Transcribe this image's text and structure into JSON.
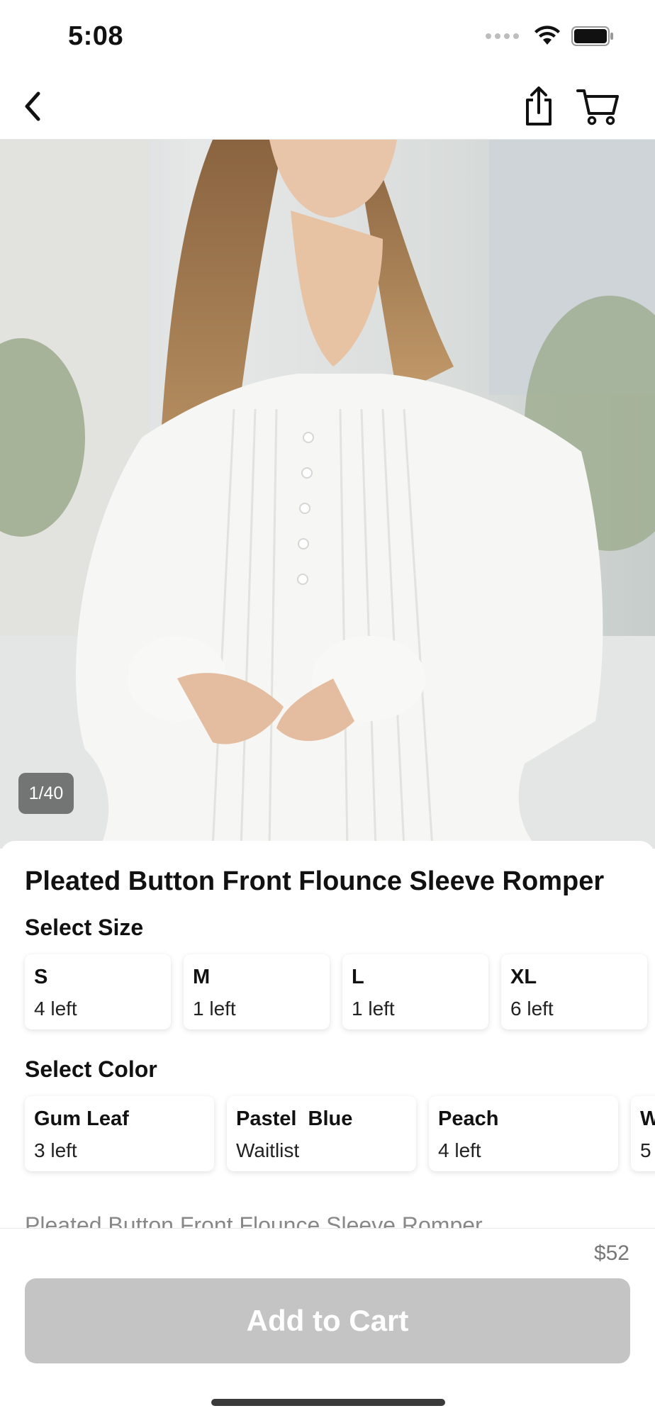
{
  "status_bar": {
    "time": "5:08",
    "icons": [
      "signal-dots-icon",
      "wifi-icon",
      "battery-icon"
    ]
  },
  "nav": {
    "icons": [
      "chevron-left-icon",
      "share-icon",
      "shopping-cart-icon"
    ]
  },
  "gallery": {
    "counter": "1/40"
  },
  "product": {
    "title": "Pleated Button Front Flounce Sleeve Romper",
    "description_preview": "Pleated Button Front Flounce Sleeve Romper",
    "price": "$52"
  },
  "size_section": {
    "title": "Select Size",
    "options": [
      {
        "name": "S",
        "stock": "4 left"
      },
      {
        "name": "M",
        "stock": "1 left"
      },
      {
        "name": "L",
        "stock": "1 left"
      },
      {
        "name": "XL",
        "stock": "6 left"
      }
    ]
  },
  "color_section": {
    "title": "Select Color",
    "options": [
      {
        "name": "Gum Leaf",
        "stock": "3 left"
      },
      {
        "name": "Pastel  Blue",
        "stock": "Waitlist"
      },
      {
        "name": "Peach",
        "stock": "4 left"
      },
      {
        "name": "W",
        "stock": "5"
      }
    ]
  },
  "actions": {
    "add_to_cart_label": "Add to Cart"
  },
  "colors": {
    "button_disabled": "#c4c4c4",
    "counter_bg": "#5a5a5a",
    "price_text": "#777777"
  }
}
